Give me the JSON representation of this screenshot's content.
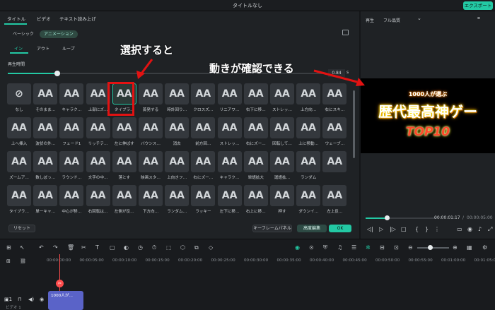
{
  "window": {
    "title": "タイトルなし",
    "export_label": "エクスポート"
  },
  "tabs": [
    "タイトル",
    "ビデオ",
    "テキスト読み上げ"
  ],
  "subtabs": [
    "ベーシック",
    "アニメーション"
  ],
  "directions": [
    "イン",
    "アウト",
    "ループ"
  ],
  "duration": {
    "label": "再生時間",
    "value": "0.84",
    "unit": "s"
  },
  "presets": [
    [
      "なし",
      "そのまま…",
      "キャラク…",
      "上部にズ…",
      "タイプラ…",
      "蒸発する",
      "時計回り…",
      "クロスズ…",
      "リニアワ…",
      "右下に移…",
      "ストレッ…",
      "上方向…",
      "右にスキ…"
    ],
    [
      "上へ挿入",
      "波状の外…",
      "フェード1",
      "リッチテ…",
      "左に伸ばす",
      "バウンス…",
      "消去",
      "前方回…",
      "ストレッ…",
      "右にズー…",
      "回転して…",
      "上に移動…",
      "ウェーブ…"
    ],
    [
      "ズームア…",
      "数しぼっ…",
      "ラウンド…",
      "文字の中…",
      "落とす",
      "映画スタ…",
      "上向きフ…",
      "右にズー…",
      "キャラク…",
      "単語拡大",
      "運語拡…",
      "ランダム",
      ""
    ],
    [
      "タイプラ…",
      "単一キャ…",
      "中心が移…",
      "右回転は…",
      "左側が反…",
      "下方向…",
      "ランダム…",
      "ラッキー",
      "左下に移…",
      "右上に移…",
      "押す",
      "ダウンイ…",
      "左上反…"
    ]
  ],
  "buttons": {
    "reset": "リセット",
    "keyframe": "キーフレームパネル",
    "advanced": "高度編集",
    "ok": "OK"
  },
  "preview_header": {
    "label": "再生",
    "quality": "フル品質"
  },
  "preview": {
    "subtitle": "1000人が選ぶ",
    "main": "歴代最高神ゲー",
    "rank": "TOP10"
  },
  "timecode": {
    "current": "00:00:01:17",
    "total": "00:00:05:00"
  },
  "ruler": [
    "00:00:00:00",
    "00:00:05:00",
    "00:00:10:00",
    "00:00:15:00",
    "00:00:20:00",
    "00:00:25:00",
    "00:00:30:00",
    "00:00:35:00",
    "00:00:40:00",
    "00:00:45:00",
    "00:00:50:00",
    "00:00:55:00",
    "00:01:00:00",
    "00:01:05:00"
  ],
  "clip": {
    "label": "1000人が…"
  },
  "track": {
    "label": "ビデオ 1"
  },
  "annotations": {
    "select": "選択すると",
    "check": "動きが確認できる"
  }
}
